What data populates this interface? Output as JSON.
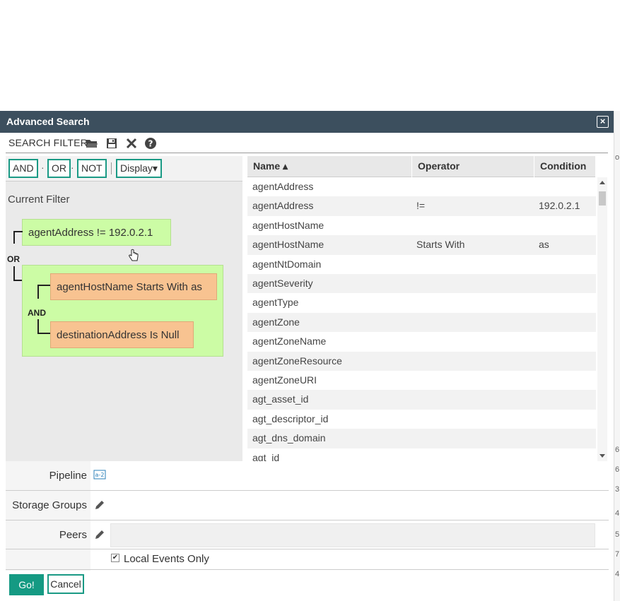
{
  "dialog": {
    "title": "Advanced Search",
    "close_label": "×"
  },
  "toolbar": {
    "label": "SEARCH FILTER"
  },
  "operators": {
    "and": "AND",
    "or": "OR",
    "not": "NOT",
    "display": "Display▾",
    "dot": "·"
  },
  "filter": {
    "heading": "Current Filter",
    "node1": "agentAddress != 192.0.2.1",
    "or_label": "OR",
    "and_label": "AND",
    "node2": "agentHostName Starts With as",
    "node3": "destinationAddress Is Null"
  },
  "table": {
    "headers": {
      "name": "Name ▴",
      "operator": "Operator",
      "condition": "Condition"
    },
    "rows": [
      {
        "name": "agentAddress",
        "operator": "",
        "condition": ""
      },
      {
        "name": "agentAddress",
        "operator": "!=",
        "condition": "192.0.2.1"
      },
      {
        "name": "agentHostName",
        "operator": "",
        "condition": ""
      },
      {
        "name": "agentHostName",
        "operator": "Starts With",
        "condition": "as"
      },
      {
        "name": "agentNtDomain",
        "operator": "",
        "condition": ""
      },
      {
        "name": "agentSeverity",
        "operator": "",
        "condition": ""
      },
      {
        "name": "agentType",
        "operator": "",
        "condition": ""
      },
      {
        "name": "agentZone",
        "operator": "",
        "condition": ""
      },
      {
        "name": "agentZoneName",
        "operator": "",
        "condition": ""
      },
      {
        "name": "agentZoneResource",
        "operator": "",
        "condition": ""
      },
      {
        "name": "agentZoneURI",
        "operator": "",
        "condition": ""
      },
      {
        "name": "agt_asset_id",
        "operator": "",
        "condition": ""
      },
      {
        "name": "agt_descriptor_id",
        "operator": "",
        "condition": ""
      },
      {
        "name": "agt_dns_domain",
        "operator": "",
        "condition": ""
      },
      {
        "name": "agt_id",
        "operator": "",
        "condition": ""
      }
    ]
  },
  "form": {
    "pipeline_label": "Pipeline",
    "storage_label": "Storage Groups",
    "peers_label": "Peers",
    "local_events_label": "Local Events Only",
    "local_events_checked": "✔"
  },
  "buttons": {
    "go": "Go!",
    "cancel": "Cancel"
  },
  "right_strip": [
    "o",
    "6",
    "6",
    "3",
    "4",
    "5",
    "7",
    "4"
  ],
  "colors": {
    "titlebar": "#3c4f5e",
    "accent": "#159a83",
    "green_node": "#ccfca5",
    "orange_node": "#f8c391"
  }
}
